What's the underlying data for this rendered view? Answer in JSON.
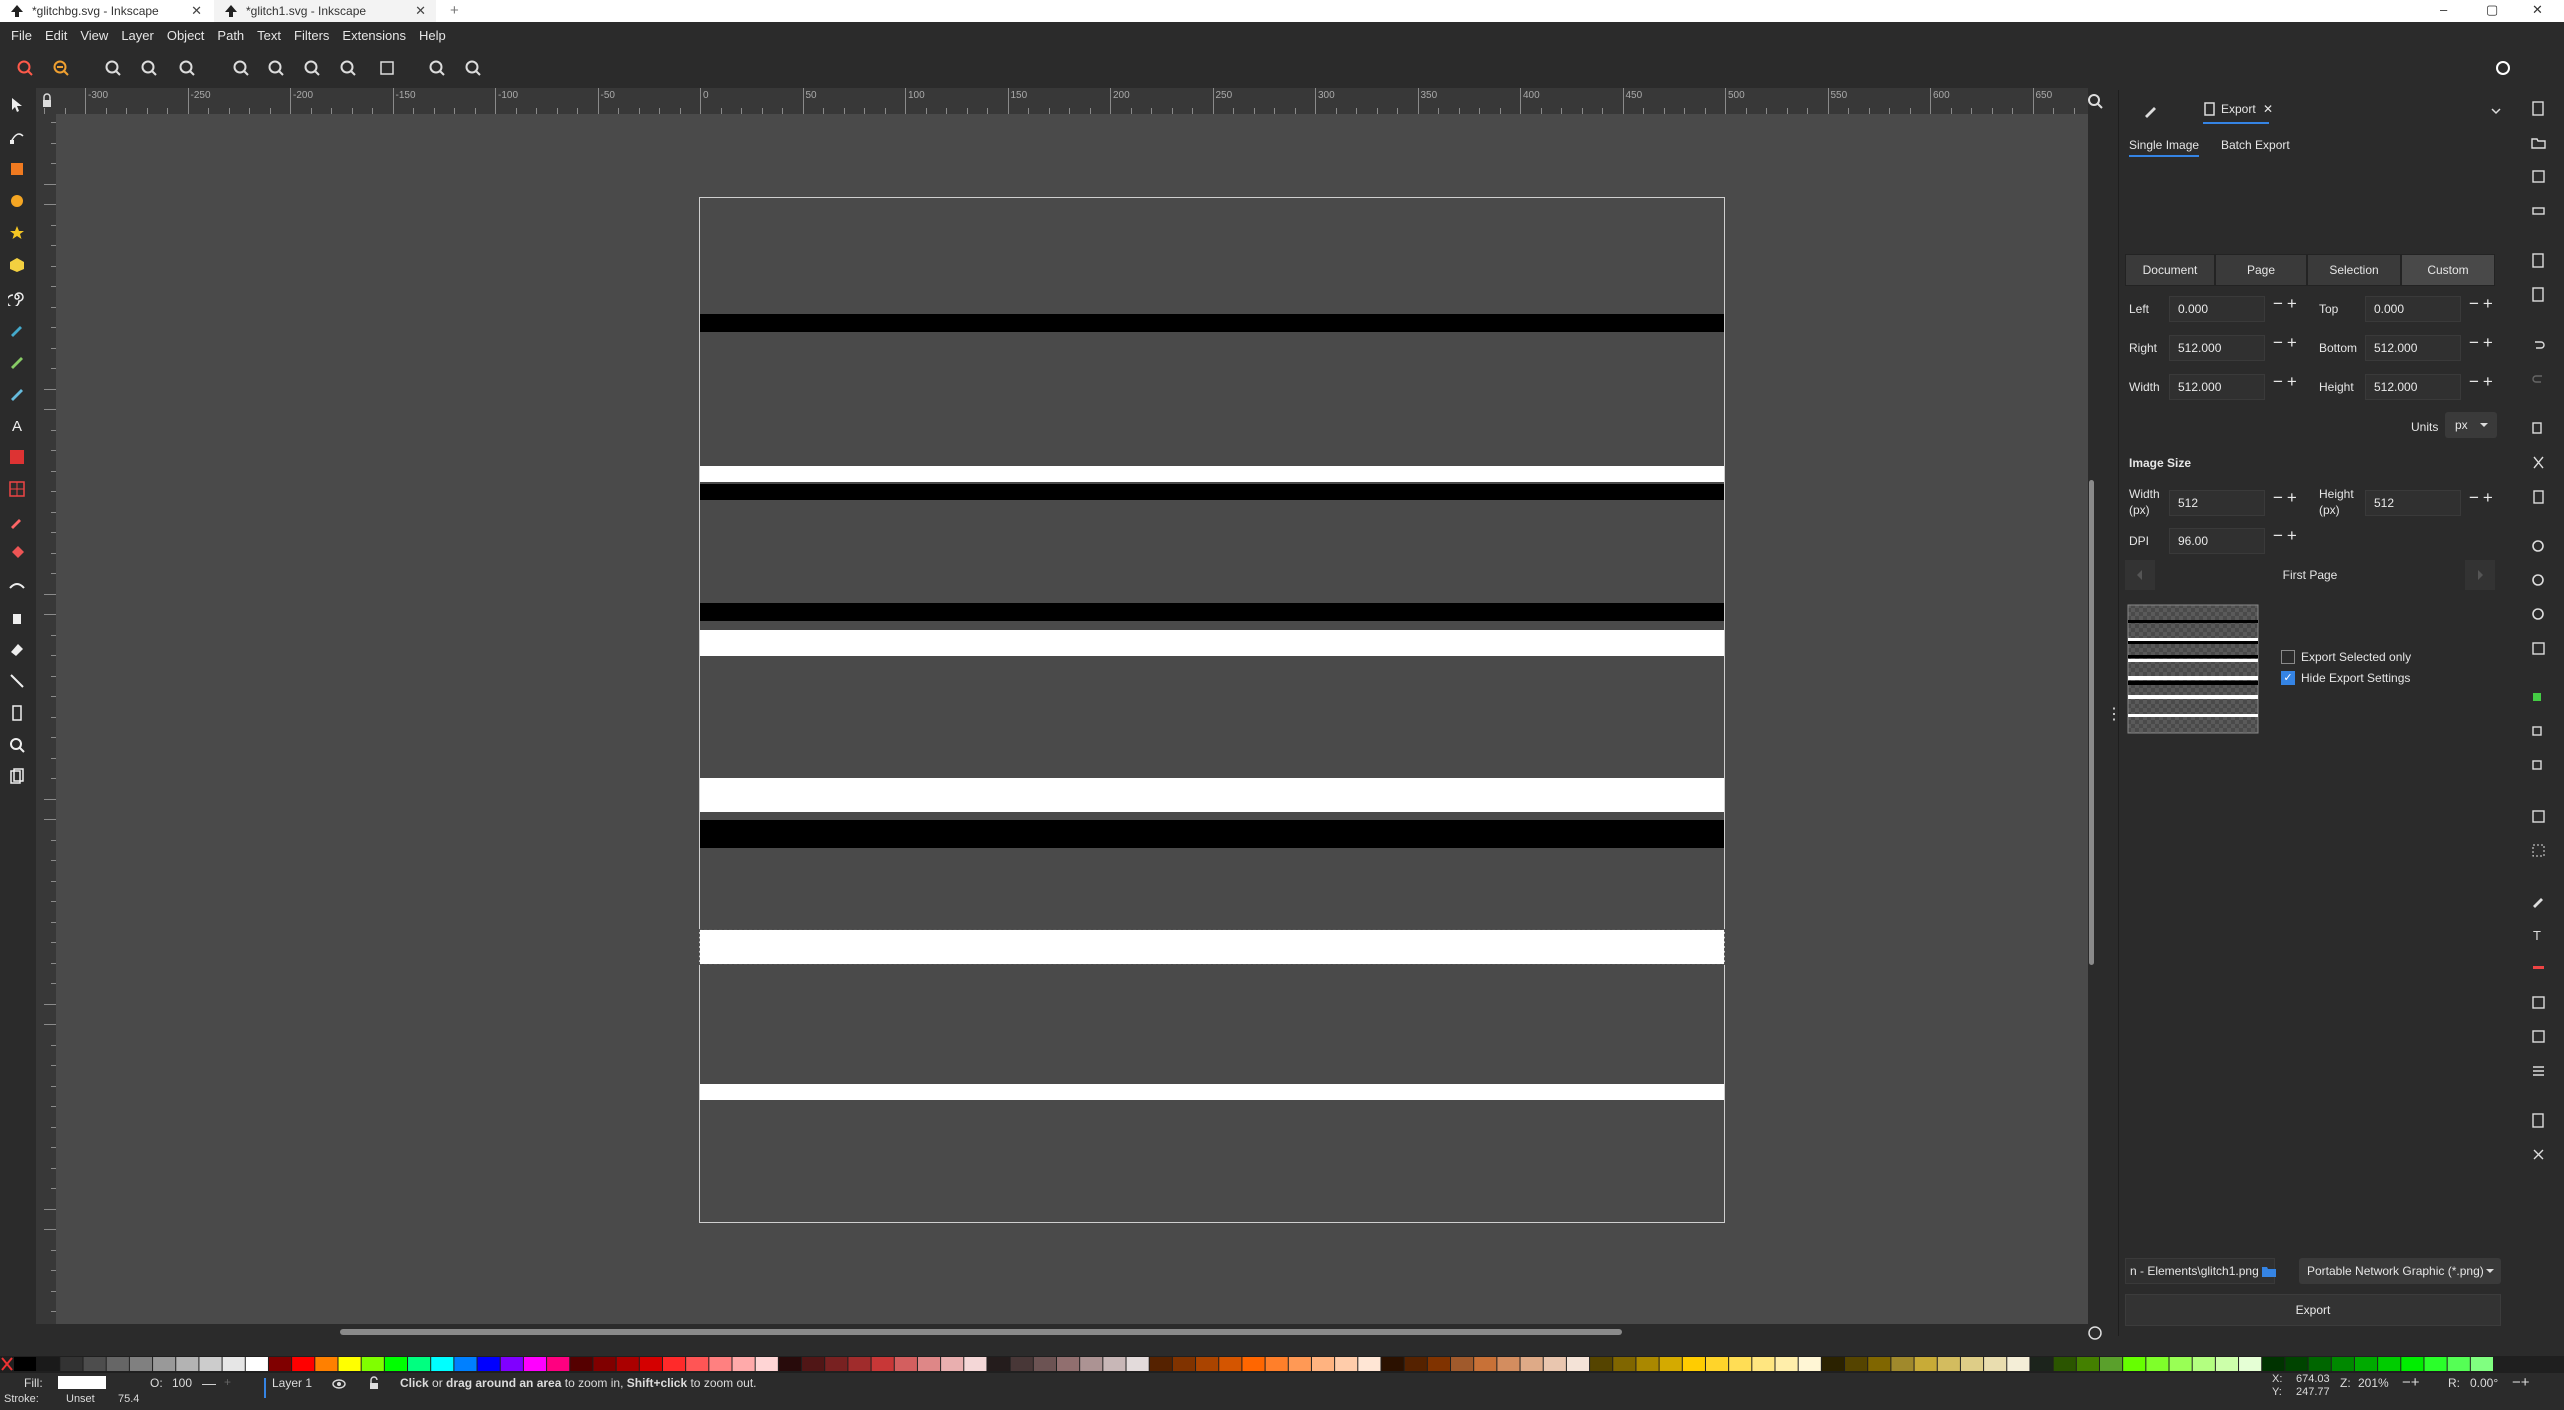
{
  "window": {
    "tabs": [
      {
        "title": "*glitchbg.svg - Inkscape"
      },
      {
        "title": "*glitch1.svg - Inkscape"
      }
    ],
    "new_tab_symbol": "+",
    "controls": {
      "minimize": "–",
      "maximize": "▢",
      "close": "✕"
    }
  },
  "menu": [
    "File",
    "Edit",
    "View",
    "Layer",
    "Object",
    "Path",
    "Text",
    "Filters",
    "Extensions",
    "Help"
  ],
  "ruler": {
    "labels": [
      "-300",
      "-250",
      "-200",
      "-150",
      "-100",
      "-50",
      "0",
      "50",
      "100",
      "150",
      "200",
      "250",
      "300",
      "350",
      "400",
      "450",
      "500",
      "550",
      "600",
      "650"
    ]
  },
  "dock": {
    "header_tab": "Export",
    "mode_tabs": [
      "Single Image",
      "Batch Export"
    ],
    "area_tabs": [
      "Document",
      "Page",
      "Selection",
      "Custom"
    ],
    "fields": {
      "left_label": "Left",
      "left_value": "0.000",
      "top_label": "Top",
      "top_value": "0.000",
      "right_label": "Right",
      "right_value": "512.000",
      "bottom_label": "Bottom",
      "bottom_value": "512.000",
      "width_label": "Width",
      "width_value": "512.000",
      "height_label": "Height",
      "height_value": "512.000"
    },
    "units_label": "Units",
    "units_value": "px",
    "image_size_title": "Image Size",
    "img_width_label": "Width\n(px)",
    "img_width_value": "512",
    "img_height_label": "Height\n(px)",
    "img_height_value": "512",
    "dpi_label": "DPI",
    "dpi_value": "96.00",
    "page_nav_label": "First Page",
    "export_selected_label": "Export Selected only",
    "export_selected_checked": false,
    "hide_settings_label": "Hide Export Settings",
    "hide_settings_checked": true,
    "filename": "n - Elements\\glitch1.png",
    "format": "Portable Network Graphic (*.png)",
    "export_button": "Export"
  },
  "status": {
    "fill_label": "Fill:",
    "stroke_label": "Stroke:",
    "stroke_value": "Unset",
    "stroke_width": "75.4",
    "opacity_label": "O:",
    "opacity_value": "100",
    "layer": "Layer 1",
    "message_bold1": "Click",
    "message_mid1": " or ",
    "message_bold2": "drag around an area",
    "message_mid2": " to zoom in, ",
    "message_bold3": "Shift+click",
    "message_end": " to zoom out.",
    "x_label": "X:",
    "x_value": "674.03",
    "y_label": "Y:",
    "y_value": "247.77",
    "zoom_label": "Z:",
    "zoom_value": "201%",
    "rotation_label": "R:",
    "rotation_value": "0.00°"
  },
  "colors": {
    "canvas": "#4a4a4a",
    "black_stripe": "#000000",
    "white_stripe": "#ffffff",
    "accent": "#3584e4"
  }
}
